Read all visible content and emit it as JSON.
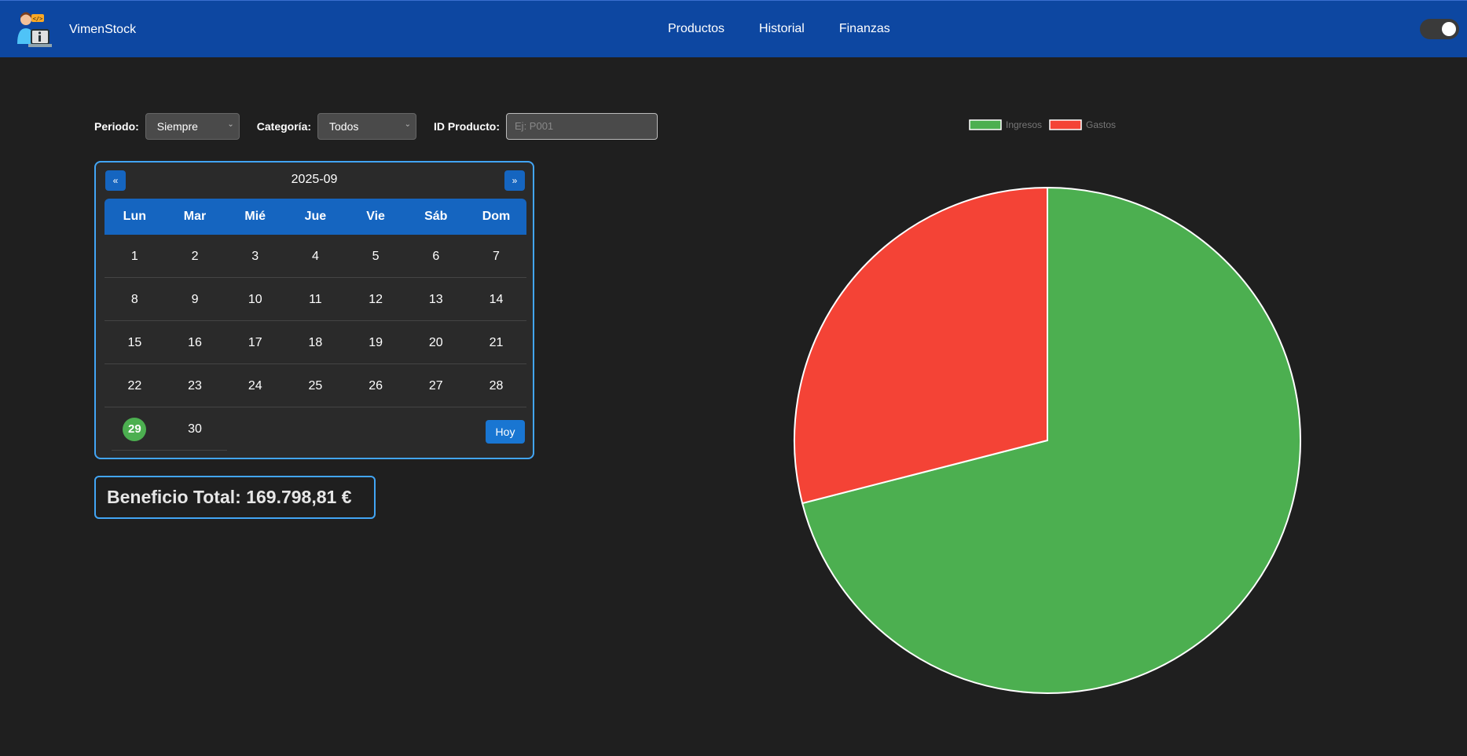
{
  "navbar": {
    "brand": "VimenStock",
    "links": [
      "Productos",
      "Historial",
      "Finanzas"
    ],
    "theme_toggle_on": true
  },
  "filters": {
    "periodo_label": "Periodo:",
    "periodo_value": "Siempre",
    "categoria_label": "Categoría:",
    "categoria_value": "Todos",
    "id_label": "ID Producto:",
    "id_placeholder": "Ej: P001"
  },
  "calendar": {
    "prev": "«",
    "next": "»",
    "month": "2025-09",
    "weekdays": [
      "Lun",
      "Mar",
      "Mié",
      "Jue",
      "Vie",
      "Sáb",
      "Dom"
    ],
    "weeks": [
      [
        "1",
        "2",
        "3",
        "4",
        "5",
        "6",
        "7"
      ],
      [
        "8",
        "9",
        "10",
        "11",
        "12",
        "13",
        "14"
      ],
      [
        "15",
        "16",
        "17",
        "18",
        "19",
        "20",
        "21"
      ],
      [
        "22",
        "23",
        "24",
        "25",
        "26",
        "27",
        "28"
      ],
      [
        "29",
        "30",
        "",
        "",
        "",
        "",
        ""
      ]
    ],
    "today": "29",
    "today_button": "Hoy"
  },
  "total": {
    "text": "Beneficio Total: 169.798,81 €"
  },
  "colors": {
    "navbar": "#0d47a1",
    "accent": "#42a5f5",
    "ingresos": "#4caf50",
    "gastos": "#f44336"
  },
  "chart_data": {
    "type": "pie",
    "categories": [
      "Ingresos",
      "Gastos"
    ],
    "values": [
      71,
      29
    ],
    "colors": [
      "#4caf50",
      "#f44336"
    ],
    "legend_position": "top"
  }
}
